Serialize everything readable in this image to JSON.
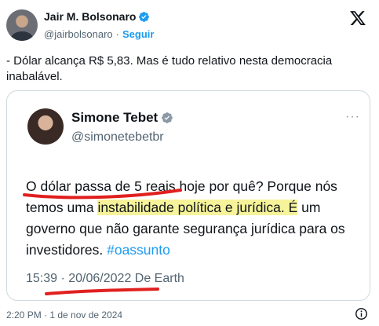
{
  "author": {
    "name": "Jair M. Bolsonaro",
    "handle": "@jairbolsonaro",
    "separator": "·",
    "follow_label": "Seguir",
    "avatar_icon": "profile-photo"
  },
  "tweet": {
    "text": "- Dólar alcança R$ 5,83. Mas é tudo relativo nesta democracia inabalável."
  },
  "quoted_screenshot": {
    "name": "Simone Tebet",
    "handle": "@simonetebetbr",
    "more": "···",
    "body_part1": "O dólar passa de 5 reais hoje por quê? Porque nós temos uma ",
    "body_highlight": "instabilidade política e jurídica. É",
    "body_part2": " um governo que não garante segurança jurídica para os investidores. ",
    "hashtag": "#oassunto",
    "date": "15:39 · 20/06/2022 De Earth",
    "highlight_color": "#f6f39a",
    "annotation_color": "#e0201f"
  },
  "footer": {
    "timestamp": "2:20 PM · 1 de nov de 2024"
  },
  "colors": {
    "accent": "#1d9bf0",
    "text": "#0f1419",
    "muted": "#536471",
    "border": "#cfd9de"
  }
}
